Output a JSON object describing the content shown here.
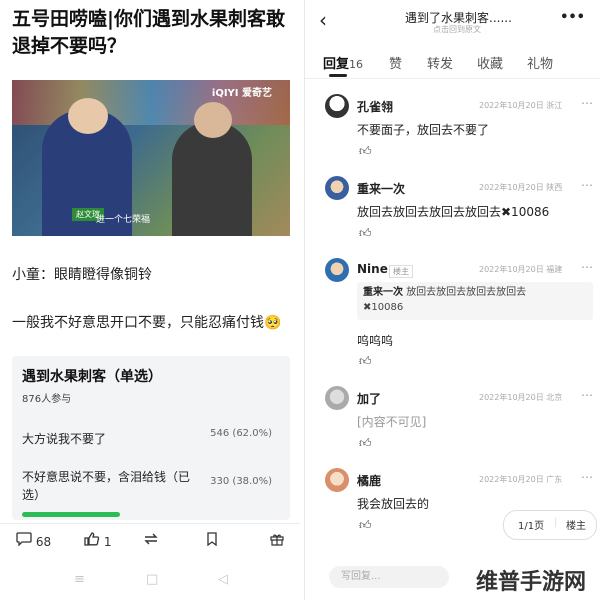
{
  "article": {
    "title": "五号田唠嗑|你们遇到水果刺客敢退掉不要吗？",
    "video_logo": "iQIYI 爱奇艺",
    "video_badge": "赵文瑄",
    "video_caption": "进一个七荣福",
    "line1": "小童：眼睛瞪得像铜铃",
    "line2": "一般我不好意思开口不要，只能忍痛付钱🥺"
  },
  "poll": {
    "title": "遇到水果刺客（单选）",
    "participants": "876人参与",
    "options": [
      {
        "label": "大方说我不要了",
        "votes": "546",
        "pct": "(62.0%)",
        "share": 0.62
      },
      {
        "label": "不好意思说不要，含泪给钱（已选）",
        "votes": "330",
        "pct": "(38.0%)",
        "share": 0.38
      }
    ]
  },
  "bottom_bar": {
    "comments": "68",
    "likes": "1"
  },
  "detail": {
    "title": "遇到了水果刺客......",
    "subtitle": "点击回到原文",
    "tabs": [
      {
        "label": "回复",
        "count": "16"
      },
      {
        "label": "赞",
        "count": ""
      },
      {
        "label": "转发",
        "count": ""
      },
      {
        "label": "收藏",
        "count": ""
      },
      {
        "label": "礼物",
        "count": ""
      }
    ]
  },
  "comments": [
    {
      "name": "孔雀翎",
      "meta": "2022年10月20日 浙江",
      "text": "不要面子，放回去不要了"
    },
    {
      "name": "重来一次",
      "meta": "2022年10月20日 陕西",
      "text": "放回去放回去放回去放回去✖10086"
    },
    {
      "name": "Nine",
      "role": "楼主",
      "meta": "2022年10月20日 福建",
      "quote_name": "重来一次",
      "quote_text": "放回去放回去放回去放回去",
      "quote_text2": "✖10086",
      "text": "呜呜呜"
    },
    {
      "name": "加了",
      "meta": "2022年10月20日 北京",
      "text": "[内容不可见]"
    },
    {
      "name": "橘鹿",
      "meta": "2022年10月20日 广东",
      "text": "我会放回去的"
    }
  ],
  "pager": {
    "page": "1/1页",
    "author": "楼主"
  },
  "reply": {
    "placeholder": "写回复..."
  },
  "watermark": "维普手游网",
  "colors": {
    "poll_bar": "#2dbb55",
    "text": "#222222",
    "muted": "#999999"
  }
}
